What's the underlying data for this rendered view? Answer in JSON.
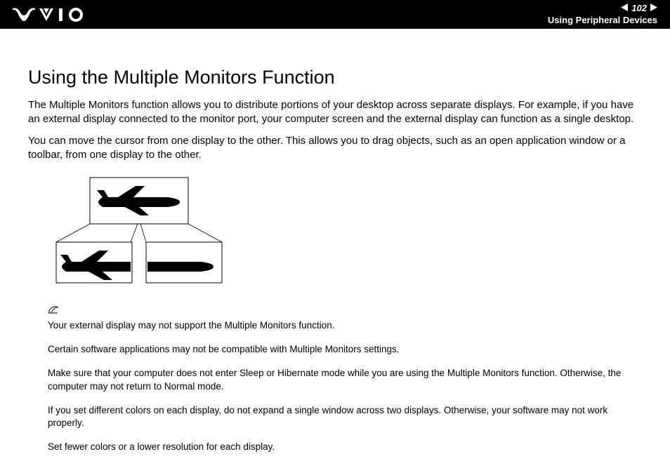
{
  "header": {
    "page_number": "102",
    "section": "Using Peripheral Devices"
  },
  "content": {
    "title": "Using the Multiple Monitors Function",
    "para1": "The Multiple Monitors function allows you to distribute portions of your desktop across separate displays. For example, if you have an external display connected to the monitor port, your computer screen and the external display can function as a single desktop.",
    "para2": "You can move the cursor from one display to the other. This allows you to drag objects, such as an open application window or a toolbar, from one display to the other."
  },
  "notes": {
    "n1": "Your external display may not support the Multiple Monitors function.",
    "n2": "Certain software applications may not be compatible with Multiple Monitors settings.",
    "n3": "Make sure that your computer does not enter Sleep or Hibernate mode while you are using the Multiple Monitors function. Otherwise, the computer may not return to Normal mode.",
    "n4": "If you set different colors on each display, do not expand a single window across two displays. Otherwise, your software may not work properly.",
    "n5": "Set fewer colors or a lower resolution for each display."
  }
}
